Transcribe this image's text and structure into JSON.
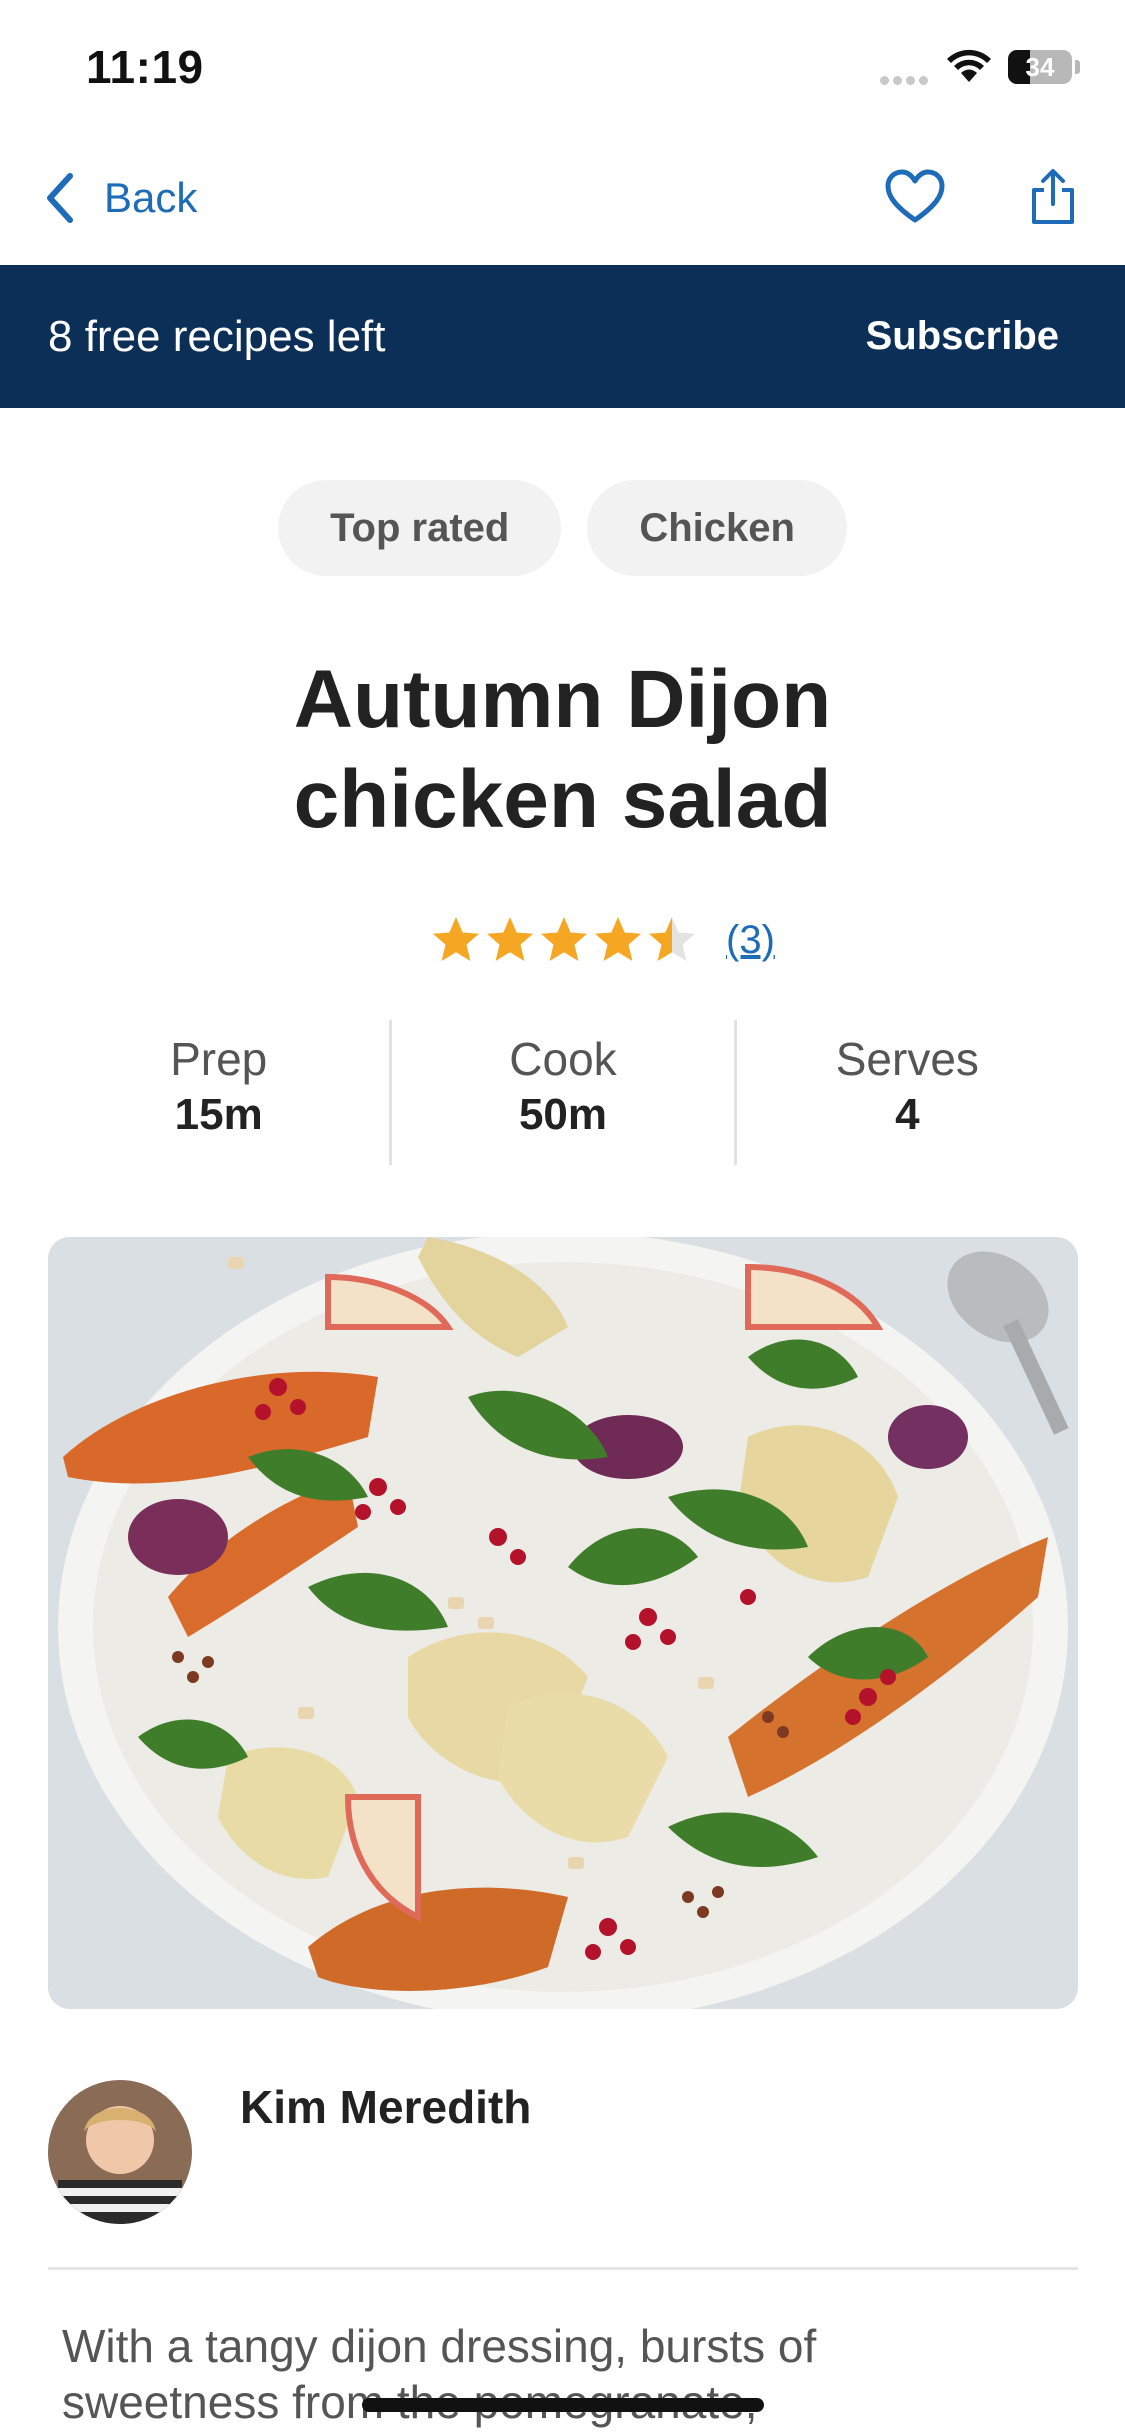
{
  "status_bar": {
    "time": "11:19",
    "battery": "34"
  },
  "nav": {
    "back_label": "Back",
    "favorite_icon": "heart-icon",
    "share_icon": "share-icon"
  },
  "banner": {
    "text": "8 free recipes left",
    "cta": "Subscribe",
    "background": "#0c2f57"
  },
  "tags": [
    "Top rated",
    "Chicken"
  ],
  "recipe": {
    "title_line1": "Autumn Dijon",
    "title_line2": "chicken salad",
    "rating": 4.5,
    "rating_max": 5,
    "rating_count": "(3)",
    "star_color": "#f5a623"
  },
  "stats": [
    {
      "label": "Prep",
      "value": "15m"
    },
    {
      "label": "Cook",
      "value": "50m"
    },
    {
      "label": "Serves",
      "value": "4"
    }
  ],
  "hero_image": {
    "alt": "Salad plate with roasted squash, chicken, rocket, pomegranate and apple"
  },
  "author": {
    "name": "Kim Meredith"
  },
  "description": "With a tangy dijon dressing, bursts of sweetness from the pomegranate,",
  "colors": {
    "link": "#1e6bb8",
    "text": "#222222",
    "muted": "#555555"
  }
}
